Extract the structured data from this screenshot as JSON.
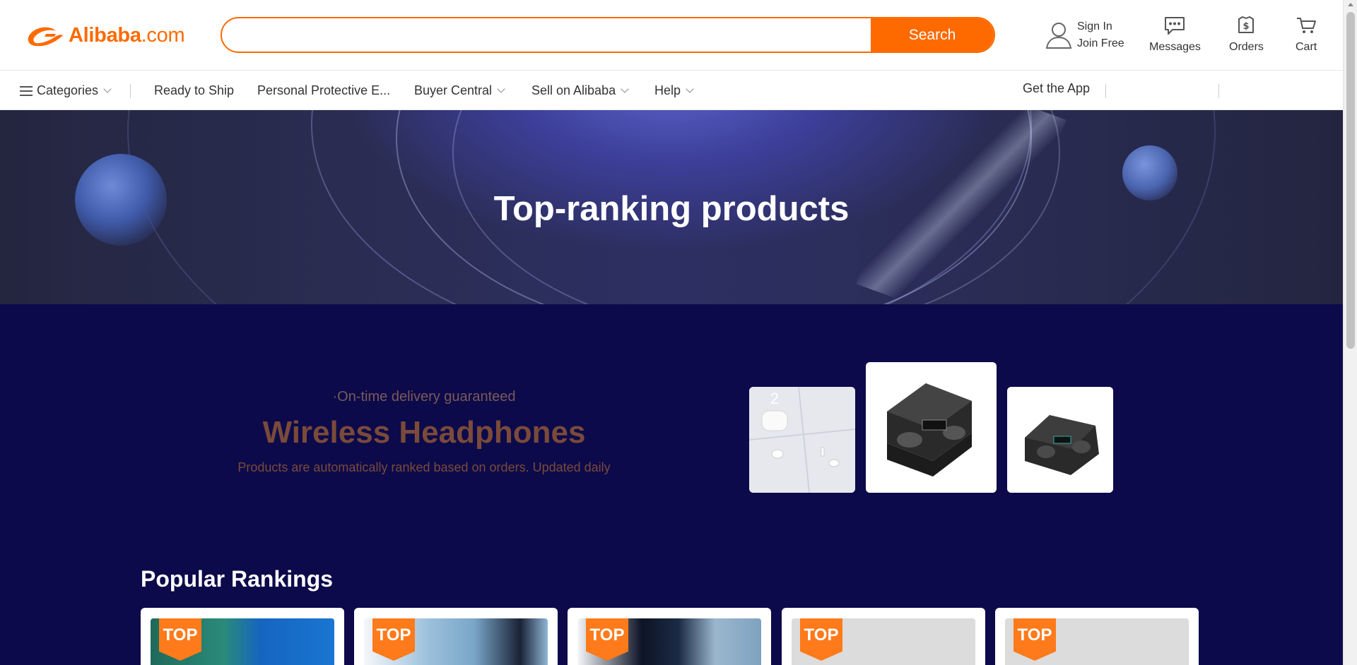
{
  "header": {
    "logo_text": "Alibaba",
    "logo_suffix": ".com",
    "search": {
      "placeholder": "",
      "value": "",
      "button_label": "Search"
    },
    "account": {
      "sign_in": "Sign In",
      "join_free": "Join Free"
    },
    "messages_label": "Messages",
    "orders_label": "Orders",
    "cart_label": "Cart"
  },
  "subnav": {
    "categories_label": "Categories",
    "items": [
      "Ready to Ship",
      "Personal Protective E...",
      "Buyer Central",
      "Sell on Alibaba",
      "Help"
    ],
    "get_app_label": "Get the App"
  },
  "banner": {
    "title": "Top-ranking products"
  },
  "promo": {
    "tag": "·On-time delivery guaranteed",
    "title": "Wireless Headphones",
    "description": "Products are automatically ranked based on orders. Updated daily",
    "thumb_rank": "2"
  },
  "popular": {
    "title": "Popular Rankings",
    "badges": [
      "TOP",
      "TOP",
      "TOP",
      "TOP",
      "TOP"
    ]
  },
  "colors": {
    "brand": "#ff6a00",
    "dark_bg": "#0c0a4a",
    "promo_text": "#7a4a3a"
  },
  "icons": [
    "alibaba-logo-icon",
    "user-icon",
    "messages-icon",
    "orders-icon",
    "cart-icon",
    "menu-icon",
    "chevron-down-icon"
  ]
}
